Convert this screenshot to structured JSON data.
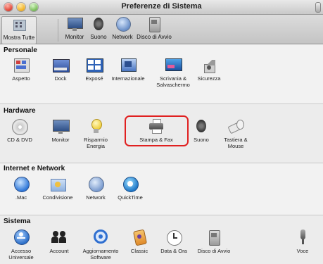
{
  "window": {
    "title": "Preferenze di Sistema"
  },
  "toolbar": {
    "items": [
      {
        "label": "Mostra Tutte",
        "icon": "grid-icon"
      },
      {
        "label": "Monitor",
        "icon": "monitor-icon"
      },
      {
        "label": "Suono",
        "icon": "speaker-icon"
      },
      {
        "label": "Network",
        "icon": "network-globe-icon"
      },
      {
        "label": "Disco di Avvio",
        "icon": "startup-disk-icon"
      }
    ]
  },
  "sections": {
    "personale": {
      "title": "Personale",
      "items": [
        {
          "label": "Aspetto",
          "icon": "appearance-icon"
        },
        {
          "label": "Dock",
          "icon": "dock-icon"
        },
        {
          "label": "Exposé",
          "icon": "expose-icon"
        },
        {
          "label": "Internazionale",
          "icon": "international-flag-icon"
        },
        {
          "label": "Scrivania &",
          "label2": "Salvaschermo",
          "icon": "desktop-screensaver-icon"
        },
        {
          "label": "Sicurezza",
          "icon": "security-house-icon"
        }
      ]
    },
    "hardware": {
      "title": "Hardware",
      "items": [
        {
          "label": "CD & DVD",
          "icon": "cd-dvd-icon"
        },
        {
          "label": "Monitor",
          "icon": "monitor-icon"
        },
        {
          "label": "Risparmio",
          "label2": "Energia",
          "icon": "energy-bulb-icon"
        },
        {
          "label": "Stampa & Fax",
          "icon": "printer-icon"
        },
        {
          "label": "Suono",
          "icon": "speaker-icon"
        },
        {
          "label": "Tastiera &",
          "label2": "Mouse",
          "icon": "keyboard-mouse-icon"
        }
      ]
    },
    "internet": {
      "title": "Internet e Network",
      "items": [
        {
          "label": ".Mac",
          "icon": "dotmac-globe-icon"
        },
        {
          "label": "Condivisione",
          "icon": "sharing-folder-icon"
        },
        {
          "label": "Network",
          "icon": "network-globe-icon"
        },
        {
          "label": "QuickTime",
          "icon": "quicktime-icon"
        }
      ]
    },
    "sistema": {
      "title": "Sistema",
      "items": [
        {
          "label": "Accesso",
          "label2": "Universale",
          "icon": "universal-access-icon"
        },
        {
          "label": "Account",
          "icon": "accounts-icon"
        },
        {
          "label": "Aggiornamento",
          "label2": "Software",
          "icon": "software-update-icon"
        },
        {
          "label": "Classic",
          "icon": "classic-icon"
        },
        {
          "label": "Data & Ora",
          "icon": "date-time-clock-icon"
        },
        {
          "label": "Disco di Avvio",
          "icon": "startup-disk-icon"
        },
        {
          "label": "Voce",
          "icon": "microphone-icon"
        }
      ]
    }
  },
  "colors": {
    "highlight": "#e02020",
    "accent_blue": "#2a6fd6"
  }
}
